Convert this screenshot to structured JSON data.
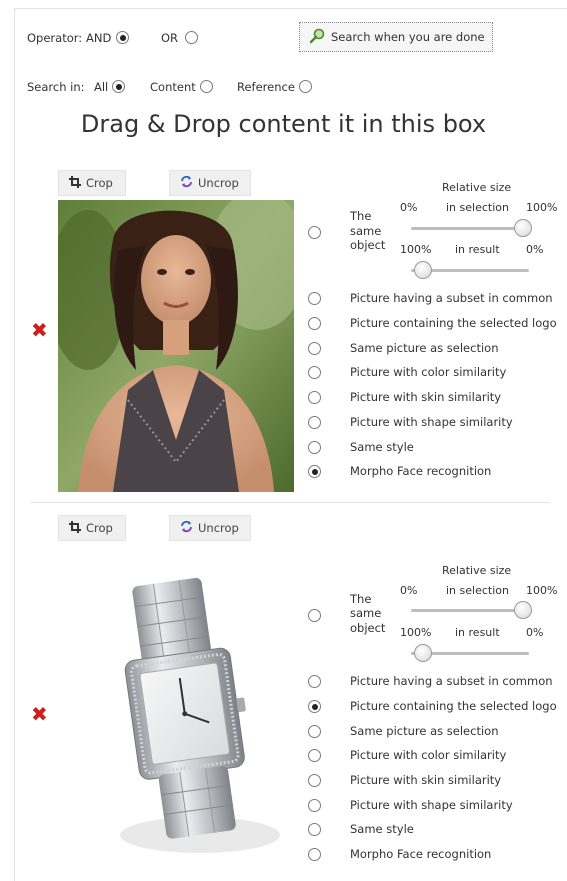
{
  "operator": {
    "label": "Operator:",
    "and_label": "AND",
    "or_label": "OR",
    "selected": "AND"
  },
  "search_button": {
    "label": "Search when you are done",
    "icon": "search-icon"
  },
  "search_in": {
    "label": "Search in:",
    "all_label": "All",
    "content_label": "Content",
    "reference_label": "Reference",
    "selected": "All"
  },
  "drop_title": "Drag & Drop content it in this box",
  "toolbar": {
    "crop_label": "Crop",
    "uncrop_label": "Uncrop"
  },
  "size": {
    "relative_size": "Relative size",
    "in_selection": "in selection",
    "in_result": "in result",
    "sel_min": "0%",
    "sel_max": "100%",
    "res_min": "100%",
    "res_max": "0%"
  },
  "same_object": {
    "line1": "The",
    "line2": "same",
    "line3": "object"
  },
  "items": [
    {
      "image": "woman-portrait",
      "selection_level": 0.95,
      "result_level": 0.1,
      "options": [
        "Picture having a subset in common",
        "Picture containing the selected logo",
        "Same picture as selection",
        "Picture with color similarity",
        "Picture with skin similarity",
        "Picture with shape similarity",
        "Same style",
        "Morpho Face recognition"
      ],
      "selected_option": "Morpho Face recognition"
    },
    {
      "image": "wristwatch",
      "selection_level": 0.95,
      "result_level": 0.1,
      "options": [
        "Picture having a subset in common",
        "Picture containing the selected logo",
        "Same picture as selection",
        "Picture with color similarity",
        "Picture with skin similarity",
        "Picture with shape similarity",
        "Same style",
        "Morpho Face recognition"
      ],
      "selected_option": "Picture containing the selected logo"
    }
  ],
  "colors": {
    "delete": "#cc1f1f",
    "slider_track": "#bdbdbd"
  }
}
